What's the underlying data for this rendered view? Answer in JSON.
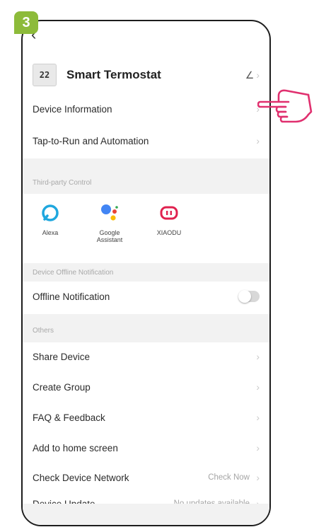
{
  "step": "3",
  "nav": {
    "back_glyph": "‹"
  },
  "device": {
    "icon_text": "22",
    "name": "Smart Termostat",
    "edit_glyph": "∠"
  },
  "rows_top": [
    {
      "label": "Device Information"
    },
    {
      "label": "Tap-to-Run and Automation"
    }
  ],
  "sections": {
    "third_party": "Third-party Control",
    "offline": "Device Offline Notification",
    "others": "Others"
  },
  "third_party": [
    {
      "label": "Alexa",
      "icon": "alexa-icon"
    },
    {
      "label": "Google Assistant",
      "icon": "google-assistant-icon"
    },
    {
      "label": "XIAODU",
      "icon": "xiaodu-icon"
    }
  ],
  "offline_row": {
    "label": "Offline Notification",
    "toggle_on": false
  },
  "others_rows": [
    {
      "label": "Share Device",
      "value": ""
    },
    {
      "label": "Create Group",
      "value": ""
    },
    {
      "label": "FAQ & Feedback",
      "value": ""
    },
    {
      "label": "Add to home screen",
      "value": ""
    },
    {
      "label": "Check Device Network",
      "value": "Check Now"
    },
    {
      "label": "Device Update",
      "value": "No updates available"
    }
  ],
  "colors": {
    "badge": "#8dbb3a",
    "pointer": "#e0306f",
    "alexa": "#1fa7de",
    "xiaodu": "#e0214f"
  }
}
